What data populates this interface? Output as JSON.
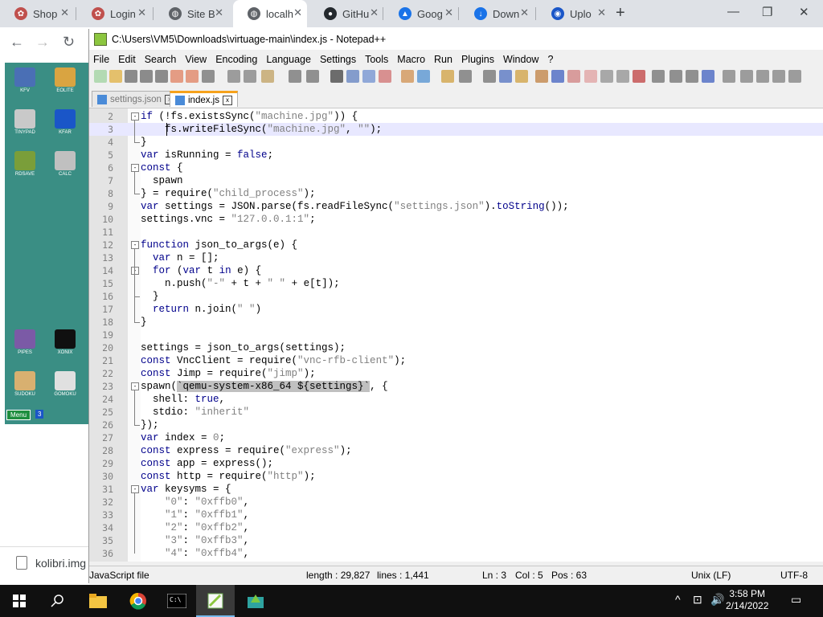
{
  "browser": {
    "tabs": [
      {
        "title": "Shop",
        "color": "#c0504d",
        "glyph": "✿"
      },
      {
        "title": "Login",
        "color": "#c0504d",
        "glyph": "✿"
      },
      {
        "title": "Site B",
        "color": "#5f6368",
        "glyph": "◍"
      },
      {
        "title": "localh",
        "color": "#5f6368",
        "glyph": "◍",
        "active": true
      },
      {
        "title": "GitHu",
        "color": "#24292e",
        "glyph": "●"
      },
      {
        "title": "Goog",
        "color": "#1a73e8",
        "glyph": "▲"
      },
      {
        "title": "Down",
        "color": "#1a73e8",
        "glyph": "↓"
      },
      {
        "title": "Uplo",
        "color": "#1a56c8",
        "glyph": "◉"
      }
    ],
    "close_glyph": "✕",
    "newtab_glyph": "+",
    "back_glyph": "←",
    "forward_glyph": "→",
    "reload_glyph": "↻",
    "window_controls": [
      "—",
      "❐",
      "✕"
    ]
  },
  "desktop": {
    "icons": [
      "KFV",
      "EOLITE",
      "TINYPAD",
      "KFAR",
      "RDSAVE",
      "CALC",
      "PIPES",
      "XONIX",
      "SUDOKU",
      "GOMOKU"
    ],
    "menu_label": "Menu",
    "menu_num": "3"
  },
  "download": {
    "filename": "kolibri.img"
  },
  "notepad": {
    "title": "C:\\Users\\VM5\\Downloads\\virtuage-main\\index.js - Notepad++",
    "menu": [
      "File",
      "Edit",
      "Search",
      "View",
      "Encoding",
      "Language",
      "Settings",
      "Tools",
      "Macro",
      "Run",
      "Plugins",
      "Window",
      "?"
    ],
    "tabs": [
      {
        "label": "settings.json",
        "active": false
      },
      {
        "label": "index.js",
        "active": true
      }
    ],
    "status": {
      "lang": "JavaScript file",
      "length": "length : 29,827",
      "lines": "lines : 1,441",
      "ln": "Ln : 3",
      "col": "Col : 5",
      "pos": "Pos : 63",
      "eol": "Unix (LF)",
      "enc": "UTF-8"
    },
    "lines": [
      {
        "n": "2",
        "fold": "open",
        "html": "<span class='kw'>if</span> (!fs.existsSync(<span class='str'>\"machine.jpg\"</span>)) {"
      },
      {
        "n": "3",
        "current": true,
        "html": "    fs.writeFileSync(<span class='str'>\"machine.jpg\"</span>, <span class='str'>\"\"</span>);"
      },
      {
        "n": "4",
        "fold": "end",
        "html": "}"
      },
      {
        "n": "5",
        "html": "<span class='kw'>var</span> isRunning = <span class='kw'>false</span>;"
      },
      {
        "n": "6",
        "fold": "open",
        "html": "<span class='kw'>const</span> {"
      },
      {
        "n": "7",
        "html": "  spawn"
      },
      {
        "n": "8",
        "fold": "end",
        "html": "} = require(<span class='str'>\"child_process\"</span>);"
      },
      {
        "n": "9",
        "html": "<span class='kw'>var</span> settings = JSON.parse(fs.readFileSync(<span class='str'>\"settings.json\"</span>).<span class='kw'>toString</span>());"
      },
      {
        "n": "10",
        "html": "settings.vnc = <span class='str'>\"127.0.0.1:1\"</span>;"
      },
      {
        "n": "11",
        "html": ""
      },
      {
        "n": "12",
        "fold": "open",
        "html": "<span class='kw'>function</span> json_to_args(e) {"
      },
      {
        "n": "13",
        "html": "  <span class='kw'>var</span> n = [];"
      },
      {
        "n": "14",
        "fold": "open",
        "html": "  <span class='kw'>for</span> (<span class='kw'>var</span> t <span class='kw'>in</span> e) {"
      },
      {
        "n": "15",
        "html": "    n.push(<span class='str'>\"-\"</span> + t + <span class='str'>\" \"</span> + e[t]);"
      },
      {
        "n": "16",
        "fold": "end",
        "html": "  }"
      },
      {
        "n": "17",
        "html": "  <span class='kw'>return</span> n.join(<span class='str'>\" \"</span>)"
      },
      {
        "n": "18",
        "fold": "end",
        "html": "}"
      },
      {
        "n": "19",
        "html": ""
      },
      {
        "n": "20",
        "html": "settings = json_to_args(settings);"
      },
      {
        "n": "21",
        "html": "<span class='kw'>const</span> VncClient = require(<span class='str'>\"vnc-rfb-client\"</span>);"
      },
      {
        "n": "22",
        "html": "<span class='kw'>const</span> Jimp = require(<span class='str'>\"jimp\"</span>);"
      },
      {
        "n": "23",
        "fold": "open",
        "html": "spawn(<span class='sel'>`qemu-system-x86_64 ${settings}`</span>, {"
      },
      {
        "n": "24",
        "html": "  shell: <span class='kw'>true</span>,"
      },
      {
        "n": "25",
        "html": "  stdio: <span class='str'>\"inherit\"</span>"
      },
      {
        "n": "26",
        "fold": "end",
        "html": "});"
      },
      {
        "n": "27",
        "html": "<span class='kw'>var</span> index = <span class='str'>0</span>;"
      },
      {
        "n": "28",
        "html": "<span class='kw'>const</span> express = require(<span class='str'>\"express\"</span>);"
      },
      {
        "n": "29",
        "html": "<span class='kw'>const</span> app = express();"
      },
      {
        "n": "30",
        "html": "<span class='kw'>const</span> http = require(<span class='str'>\"http\"</span>);"
      },
      {
        "n": "31",
        "fold": "open",
        "html": "<span class='kw'>var</span> keysyms = {"
      },
      {
        "n": "32",
        "html": "    <span class='str'>\"0\"</span>: <span class='str'>\"0xffb0\"</span>,"
      },
      {
        "n": "33",
        "html": "    <span class='str'>\"1\"</span>: <span class='str'>\"0xffb1\"</span>,"
      },
      {
        "n": "34",
        "html": "    <span class='str'>\"2\"</span>: <span class='str'>\"0xffb2\"</span>,"
      },
      {
        "n": "35",
        "html": "    <span class='str'>\"3\"</span>: <span class='str'>\"0xffb3\"</span>,"
      },
      {
        "n": "36",
        "html": "    <span class='str'>\"4\"</span>: <span class='str'>\"0xffb4\"</span>,"
      }
    ]
  },
  "taskbar": {
    "time": "3:58 PM",
    "date": "2/14/2022",
    "tray": [
      "^",
      "⊡",
      "🔊",
      "▭"
    ]
  }
}
